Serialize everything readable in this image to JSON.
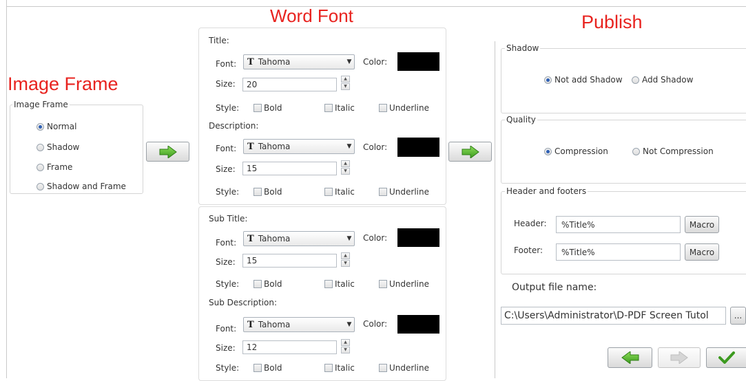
{
  "headings": {
    "image_frame": "Image Frame",
    "word_font": "Word Font",
    "publish": "Publish"
  },
  "image_frame": {
    "group_label": "Image Frame",
    "options": [
      "Normal",
      "Shadow",
      "Frame",
      "Shadow and Frame"
    ],
    "selected": "Normal"
  },
  "word_font": {
    "sections": [
      {
        "heading": "Title:",
        "font_label": "Font:",
        "font_value": "Tahoma",
        "color_label": "Color:",
        "color": "#000000",
        "size_label": "Size:",
        "size_value": "20",
        "style_label": "Style:",
        "bold": "Bold",
        "italic": "Italic",
        "underline": "Underline"
      },
      {
        "heading": "Description:",
        "font_label": "Font:",
        "font_value": "Tahoma",
        "color_label": "Color:",
        "color": "#000000",
        "size_label": "Size:",
        "size_value": "15",
        "style_label": "Style:",
        "bold": "Bold",
        "italic": "Italic",
        "underline": "Underline"
      },
      {
        "heading": "Sub Title:",
        "font_label": "Font:",
        "font_value": "Tahoma",
        "color_label": "Color:",
        "color": "#000000",
        "size_label": "Size:",
        "size_value": "15",
        "style_label": "Style:",
        "bold": "Bold",
        "italic": "Italic",
        "underline": "Underline"
      },
      {
        "heading": "Sub Description:",
        "font_label": "Font:",
        "font_value": "Tahoma",
        "color_label": "Color:",
        "color": "#000000",
        "size_label": "Size:",
        "size_value": "12",
        "style_label": "Style:",
        "bold": "Bold",
        "italic": "Italic",
        "underline": "Underline"
      }
    ]
  },
  "publish": {
    "shadow": {
      "group_label": "Shadow",
      "options": [
        "Not add Shadow",
        "Add Shadow"
      ],
      "selected": "Not add Shadow"
    },
    "quality": {
      "group_label": "Quality",
      "options": [
        "Compression",
        "Not Compression"
      ],
      "selected": "Compression"
    },
    "header_footer": {
      "group_label": "Header and footers",
      "header_label": "Header:",
      "header_value": "%Title%",
      "footer_label": "Footer:",
      "footer_value": "%Title%",
      "macro_label": "Macro"
    },
    "output": {
      "label": "Output file name:",
      "value": "C:\\Users\\Administrator\\D-PDF Screen Tutol",
      "browse_label": "..."
    }
  },
  "icons": {
    "next": "green-right-arrow-icon",
    "back": "green-left-arrow-icon",
    "forward_disabled": "gray-right-arrow-icon",
    "finish": "green-check-icon",
    "font_type": "truetype-font-icon"
  },
  "colors": {
    "heading_red": "#e8231f",
    "arrow_green": "#4caf2a",
    "radio_selected": "#2d5fb4"
  }
}
